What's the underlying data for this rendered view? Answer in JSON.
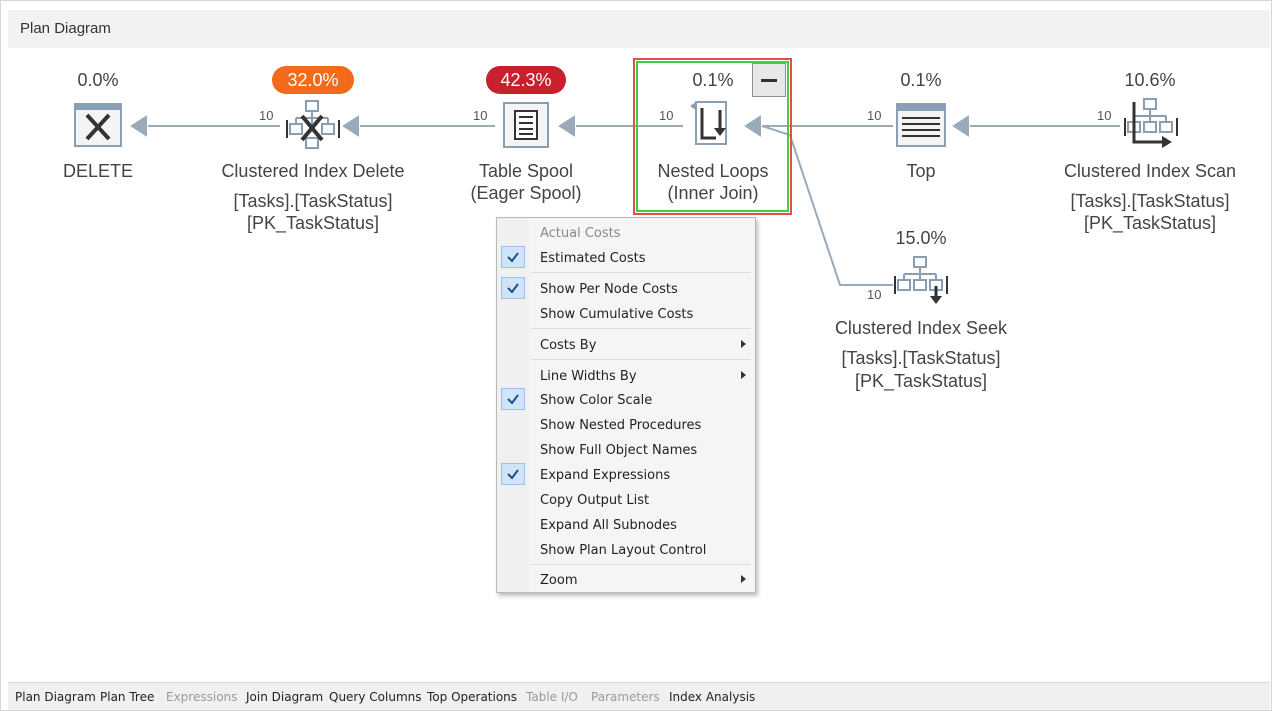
{
  "header": {
    "title": "Plan Diagram"
  },
  "nodes": {
    "delete": {
      "pct": "0.0%",
      "name": "DELETE",
      "icon": "delete-icon"
    },
    "cidelete": {
      "pct": "32.0%",
      "pct_color": "#f26a1b",
      "name": "Clustered Index Delete",
      "line2": "[Tasks].[TaskStatus]",
      "line3": "[PK_TaskStatus]",
      "rows": "10",
      "icon": "clustered-index-delete-icon"
    },
    "spool": {
      "pct": "42.3%",
      "pct_color": "#c8202c",
      "name": "Table Spool",
      "line2": "(Eager Spool)",
      "rows": "10",
      "icon": "table-spool-icon"
    },
    "nested": {
      "pct": "0.1%",
      "name": "Nested Loops",
      "line2": "(Inner Join)",
      "rows": "10",
      "icon": "nested-loops-icon"
    },
    "top": {
      "pct": "0.1%",
      "name": "Top",
      "rows": "10",
      "icon": "top-icon"
    },
    "ciscan": {
      "pct": "10.6%",
      "name": "Clustered Index Scan",
      "line2": "[Tasks].[TaskStatus]",
      "line3": "[PK_TaskStatus]",
      "rows": "10",
      "icon": "clustered-index-scan-icon"
    },
    "ciseek": {
      "pct": "15.0%",
      "name": "Clustered Index Seek",
      "line2": "[Tasks].[TaskStatus]",
      "line3": "[PK_TaskStatus]",
      "rows": "10",
      "icon": "clustered-index-seek-icon"
    }
  },
  "menu": {
    "items": [
      {
        "label": "Actual Costs",
        "checked": false,
        "disabled": true,
        "submenu": false
      },
      {
        "label": "Estimated Costs",
        "checked": true,
        "disabled": false,
        "submenu": false
      },
      {
        "label": "Show Per Node Costs",
        "checked": true,
        "disabled": false,
        "submenu": false
      },
      {
        "label": "Show Cumulative Costs",
        "checked": false,
        "disabled": false,
        "submenu": false
      },
      {
        "label": "Costs By",
        "checked": false,
        "disabled": false,
        "submenu": true
      },
      {
        "label": "Line Widths By",
        "checked": false,
        "disabled": false,
        "submenu": true
      },
      {
        "label": "Show Color Scale",
        "checked": true,
        "disabled": false,
        "submenu": false
      },
      {
        "label": "Show Nested Procedures",
        "checked": false,
        "disabled": false,
        "submenu": false
      },
      {
        "label": "Show Full Object Names",
        "checked": false,
        "disabled": false,
        "submenu": false
      },
      {
        "label": "Expand Expressions",
        "checked": true,
        "disabled": false,
        "submenu": false
      },
      {
        "label": "Copy Output List",
        "checked": false,
        "disabled": false,
        "submenu": false
      },
      {
        "label": "Expand All Subnodes",
        "checked": false,
        "disabled": false,
        "submenu": false
      },
      {
        "label": "Show Plan Layout Control",
        "checked": false,
        "disabled": false,
        "submenu": false
      },
      {
        "label": "Zoom",
        "checked": false,
        "disabled": false,
        "submenu": true
      }
    ]
  },
  "tabs": [
    {
      "label": "Plan Diagram",
      "disabled": false
    },
    {
      "label": "Plan Tree",
      "disabled": false
    },
    {
      "label": "Expressions",
      "disabled": true
    },
    {
      "label": "Join Diagram",
      "disabled": false
    },
    {
      "label": "Query Columns",
      "disabled": false
    },
    {
      "label": "Top Operations",
      "disabled": false
    },
    {
      "label": "Table I/O",
      "disabled": true
    },
    {
      "label": "Parameters",
      "disabled": true
    },
    {
      "label": "Index Analysis",
      "disabled": false
    }
  ],
  "colors": {
    "edge": "#9aaab8",
    "selection_outer": "#e05050",
    "selection_inner": "#40d040",
    "check_bg": "#cfe4f5"
  }
}
